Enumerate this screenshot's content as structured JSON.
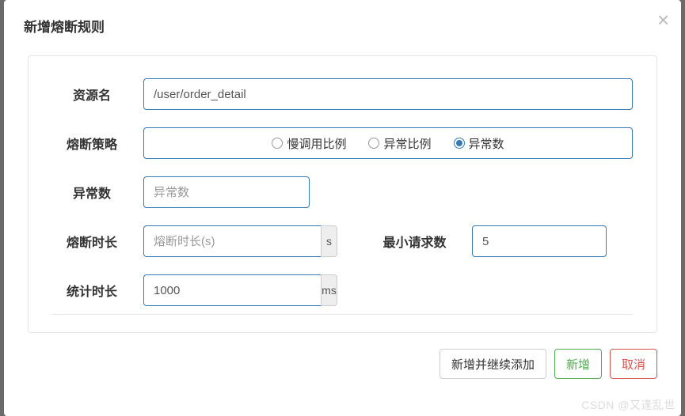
{
  "modal": {
    "title": "新增熔断规则"
  },
  "labels": {
    "resource": "资源名",
    "strategy": "熔断策略",
    "exception_count": "异常数",
    "break_duration": "熔断时长",
    "min_requests": "最小请求数",
    "stat_duration": "统计时长"
  },
  "fields": {
    "resource_value": "/user/order_detail",
    "exception_count_placeholder": "异常数",
    "break_duration_placeholder": "熔断时长(s)",
    "break_unit": "s",
    "min_requests_value": "5",
    "stat_duration_value": "1000",
    "stat_unit": "ms"
  },
  "strategy_options": {
    "slow": "慢调用比例",
    "error_ratio": "异常比例",
    "error_count": "异常数"
  },
  "footer": {
    "add_continue": "新增并继续添加",
    "add": "新增",
    "cancel": "取消"
  },
  "watermark": "CSDN @又逢乱世"
}
